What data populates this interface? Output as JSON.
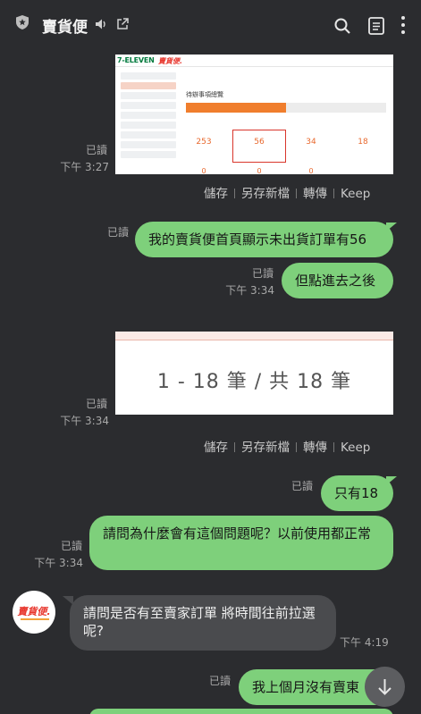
{
  "header": {
    "title": "賣貨便"
  },
  "image1": {
    "read": "已讀",
    "time": "下午 3:27",
    "screenshot": {
      "logo": "7-ELEVEN",
      "brand": "賣貨便.",
      "heading": "待辦事項總覽",
      "counts": [
        "253",
        "56",
        "34",
        "18"
      ],
      "zeros": [
        "0",
        "0",
        "0"
      ]
    },
    "actions": {
      "save": "儲存",
      "save_as": "另存新檔",
      "forward": "轉傳",
      "keep": "Keep"
    }
  },
  "messages": {
    "m1": {
      "read": "已讀",
      "text": "我的賣貨便首頁顯示未出貨訂單有56"
    },
    "m2": {
      "read": "已讀",
      "time": "下午 3:34",
      "text": "但點進去之後"
    }
  },
  "image2": {
    "read": "已讀",
    "time": "下午 3:34",
    "text": "1 - 18 筆 / 共 18 筆",
    "actions": {
      "save": "儲存",
      "save_as": "另存新檔",
      "forward": "轉傳",
      "keep": "Keep"
    }
  },
  "messages2": {
    "m3": {
      "read": "已讀",
      "text": "只有18"
    },
    "m4": {
      "read": "已讀",
      "time": "下午 3:34",
      "text": "請問為什麼會有這個問題呢？以前使用都正常"
    },
    "reply": {
      "avatar_text": "賣貨便.",
      "text": "請問是否有至賣家訂單 將時間往前拉選呢?",
      "time": "下午 4:19"
    },
    "m5": {
      "read": "已讀",
      "text": "我上個月沒有賣東"
    }
  },
  "colors": {
    "background": "#2b2c2f",
    "outgoing_bubble": "#7ed07b",
    "incoming_bubble": "#4a4b4e"
  },
  "icons": [
    "shield-icon",
    "speaker-icon",
    "external-link-icon",
    "search-icon",
    "notes-icon",
    "more-icon",
    "chevron-down-icon"
  ]
}
